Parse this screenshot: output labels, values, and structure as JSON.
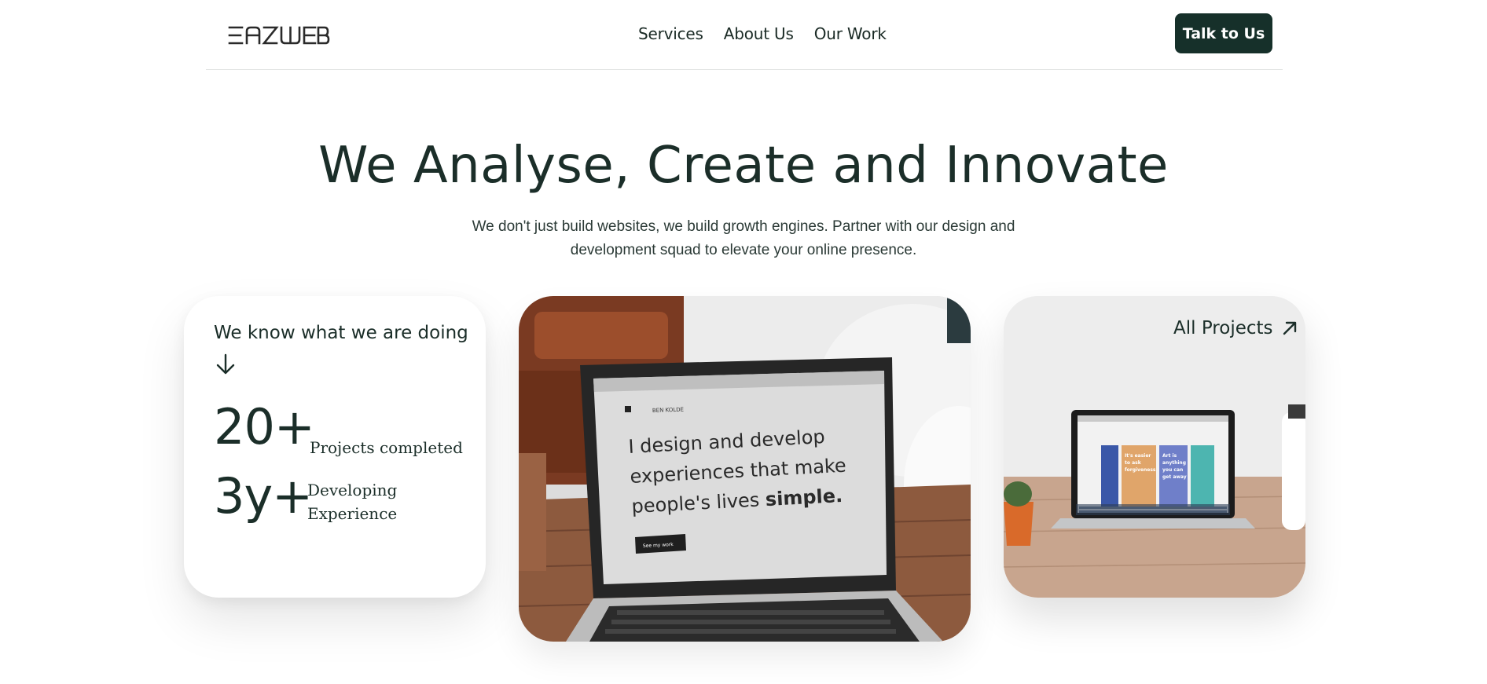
{
  "header": {
    "logo_text": "EAZWEB",
    "nav": [
      "Services",
      "About Us",
      "Our Work"
    ],
    "cta_label": "Talk to Us"
  },
  "hero": {
    "title": "We Analyse, Create and Innovate",
    "subtitle": "We don't just build websites, we build growth engines. Partner with our design and development squad to elevate your online presence."
  },
  "stats": {
    "heading": "We know what we are doing",
    "items": [
      {
        "value": "20+",
        "label": "Projects completed"
      },
      {
        "value": "3y+",
        "label": "Developing Experience"
      }
    ]
  },
  "photo_main": {
    "site_name": "BEN KOLDE",
    "screen_text": "I design and develop experiences that make people's lives",
    "screen_text_bold": "simple.",
    "button_label": "See my work"
  },
  "projects": {
    "link_label": "All Projects",
    "tile_texts": [
      "It's easier to ask forgiveness than it is to get permission",
      "Art is anything you can get away with"
    ]
  },
  "colors": {
    "primary": "#16302a",
    "text": "#1b2e29",
    "background": "#ffffff"
  }
}
